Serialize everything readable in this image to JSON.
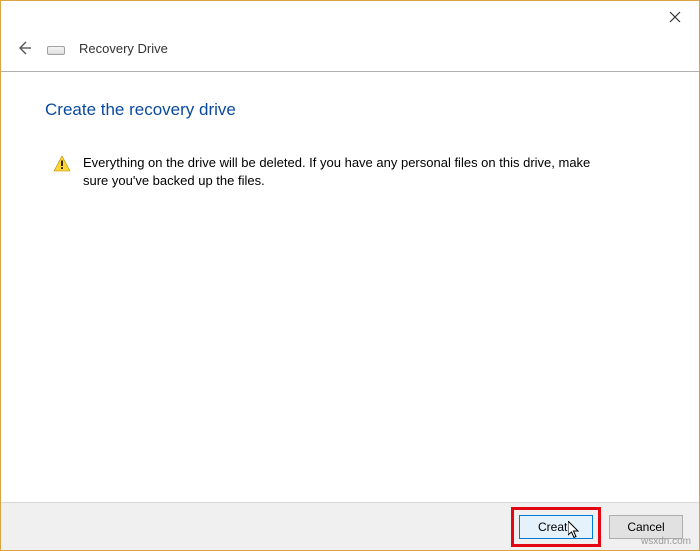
{
  "titlebar": {
    "close_label": "Close"
  },
  "header": {
    "back_label": "Back",
    "drive_icon_label": "Recovery Drive",
    "window_title": "Recovery Drive"
  },
  "content": {
    "heading": "Create the recovery drive",
    "warning_text": "Everything on the drive will be deleted. If you have any personal files on this drive, make sure you've backed up the files."
  },
  "footer": {
    "create_label": "Create",
    "cancel_label": "Cancel"
  },
  "watermark": "wsxdn.com"
}
